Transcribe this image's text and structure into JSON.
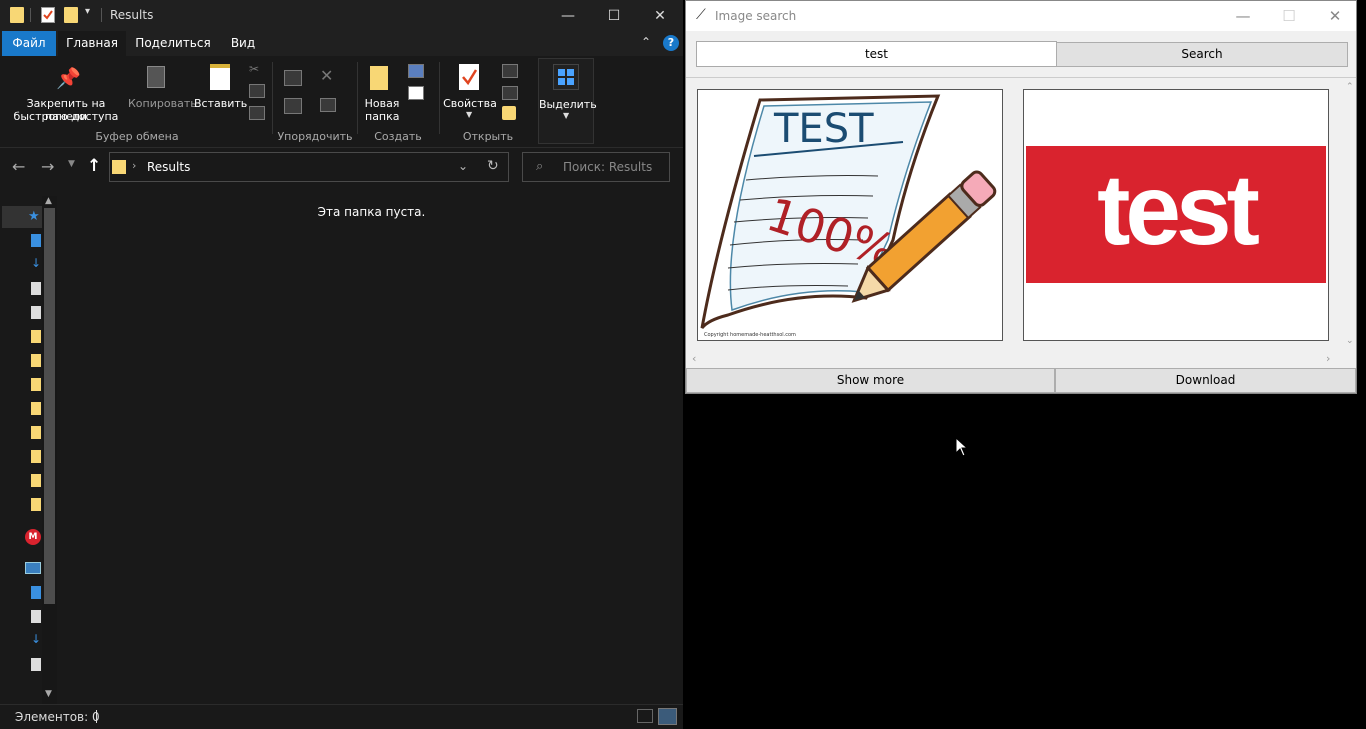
{
  "explorer": {
    "window_title": "Results",
    "tabs": [
      "Файл",
      "Главная",
      "Поделиться",
      "Вид"
    ],
    "ribbon": {
      "pin_label_1": "Закрепить на панели",
      "pin_label_2": "быстрого доступа",
      "copy_label": "Копировать",
      "paste_label": "Вставить",
      "new_folder_label_1": "Новая",
      "new_folder_label_2": "папка",
      "properties_label": "Свойства",
      "select_label": "Выделить",
      "groups": [
        "Буфер обмена",
        "Упорядочить",
        "Создать",
        "Открыть"
      ]
    },
    "address": {
      "path": "Results",
      "search_placeholder": "Поиск: Results"
    },
    "empty_text": "Эта папка пуста.",
    "status": "Элементов: 0"
  },
  "image_search": {
    "window_title": "Image search",
    "query": "test",
    "search_label": "Search",
    "show_more_label": "Show more",
    "download_label": "Download",
    "results": [
      {
        "image_heading": "TEST",
        "image_score": "100%",
        "copyright": "Copyright homemade-heatthsol.com"
      },
      {
        "image_text": "test"
      }
    ],
    "colors": {
      "test_banner": "#d9232e"
    }
  }
}
